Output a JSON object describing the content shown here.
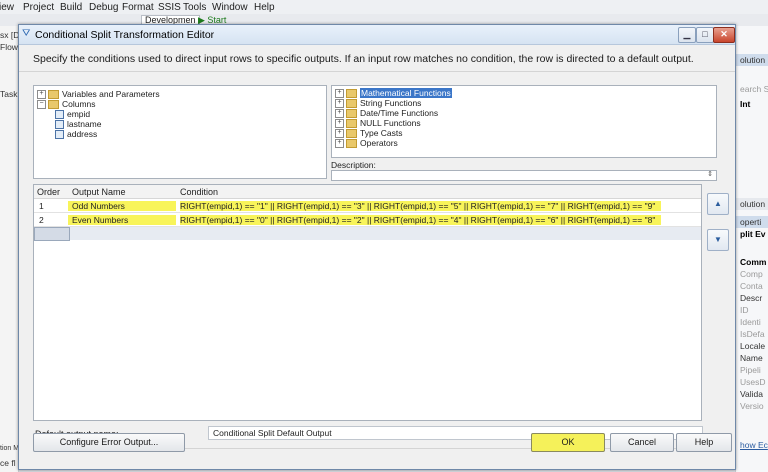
{
  "ide": {
    "menu": [
      "iew",
      "Project",
      "Build",
      "Debug",
      "Format",
      "SSIS",
      "Tools",
      "Window",
      "Help"
    ],
    "toolbar": {
      "config": "Developmen",
      "start": "▶ Start"
    },
    "left_labels": [
      "sx [D",
      "Flow",
      "Task",
      "tion M",
      "ce fl"
    ],
    "right_labels": [
      "olution",
      "earch S",
      "Int",
      "olution",
      "operti",
      "plit Ev",
      "Comm",
      "Comp",
      "Conta",
      "Descr",
      "ID",
      "Identi",
      "IsDefa",
      "Locale",
      "Name",
      "Pipeli",
      "UsesD",
      "Valida",
      "Versio",
      "how Ec"
    ]
  },
  "dialog": {
    "title": "Conditional Split Transformation Editor",
    "instructions": "Specify the conditions used to direct input rows to specific outputs. If an input row matches no condition, the row is directed to a default output.",
    "input_tree": {
      "groups": [
        "Variables and Parameters",
        "Columns"
      ],
      "columns": [
        "empid",
        "lastname",
        "address"
      ]
    },
    "functions_tree": [
      "Mathematical Functions",
      "String Functions",
      "Date/Time Functions",
      "NULL Functions",
      "Type Casts",
      "Operators"
    ],
    "description_label": "Description:",
    "grid": {
      "headers": [
        "Order",
        "Output Name",
        "Condition"
      ],
      "rows": [
        {
          "order": "1",
          "name": "Odd Numbers",
          "condition": "RIGHT(empid,1) == \"1\" || RIGHT(empid,1) == \"3\" || RIGHT(empid,1) == \"5\" || RIGHT(empid,1) == \"7\" || RIGHT(empid,1) == \"9\""
        },
        {
          "order": "2",
          "name": "Even Numbers",
          "condition": "RIGHT(empid,1) == \"0\" || RIGHT(empid,1) == \"2\" || RIGHT(empid,1) == \"4\" || RIGHT(empid,1) == \"6\" || RIGHT(empid,1) == \"8\""
        }
      ]
    },
    "default_output_label": "Default output name:",
    "default_output_value": "Conditional Split Default Output",
    "buttons": {
      "configure_error": "Configure Error Output...",
      "ok": "OK",
      "cancel": "Cancel",
      "help": "Help"
    },
    "highlight_color": "#f8f45a"
  }
}
